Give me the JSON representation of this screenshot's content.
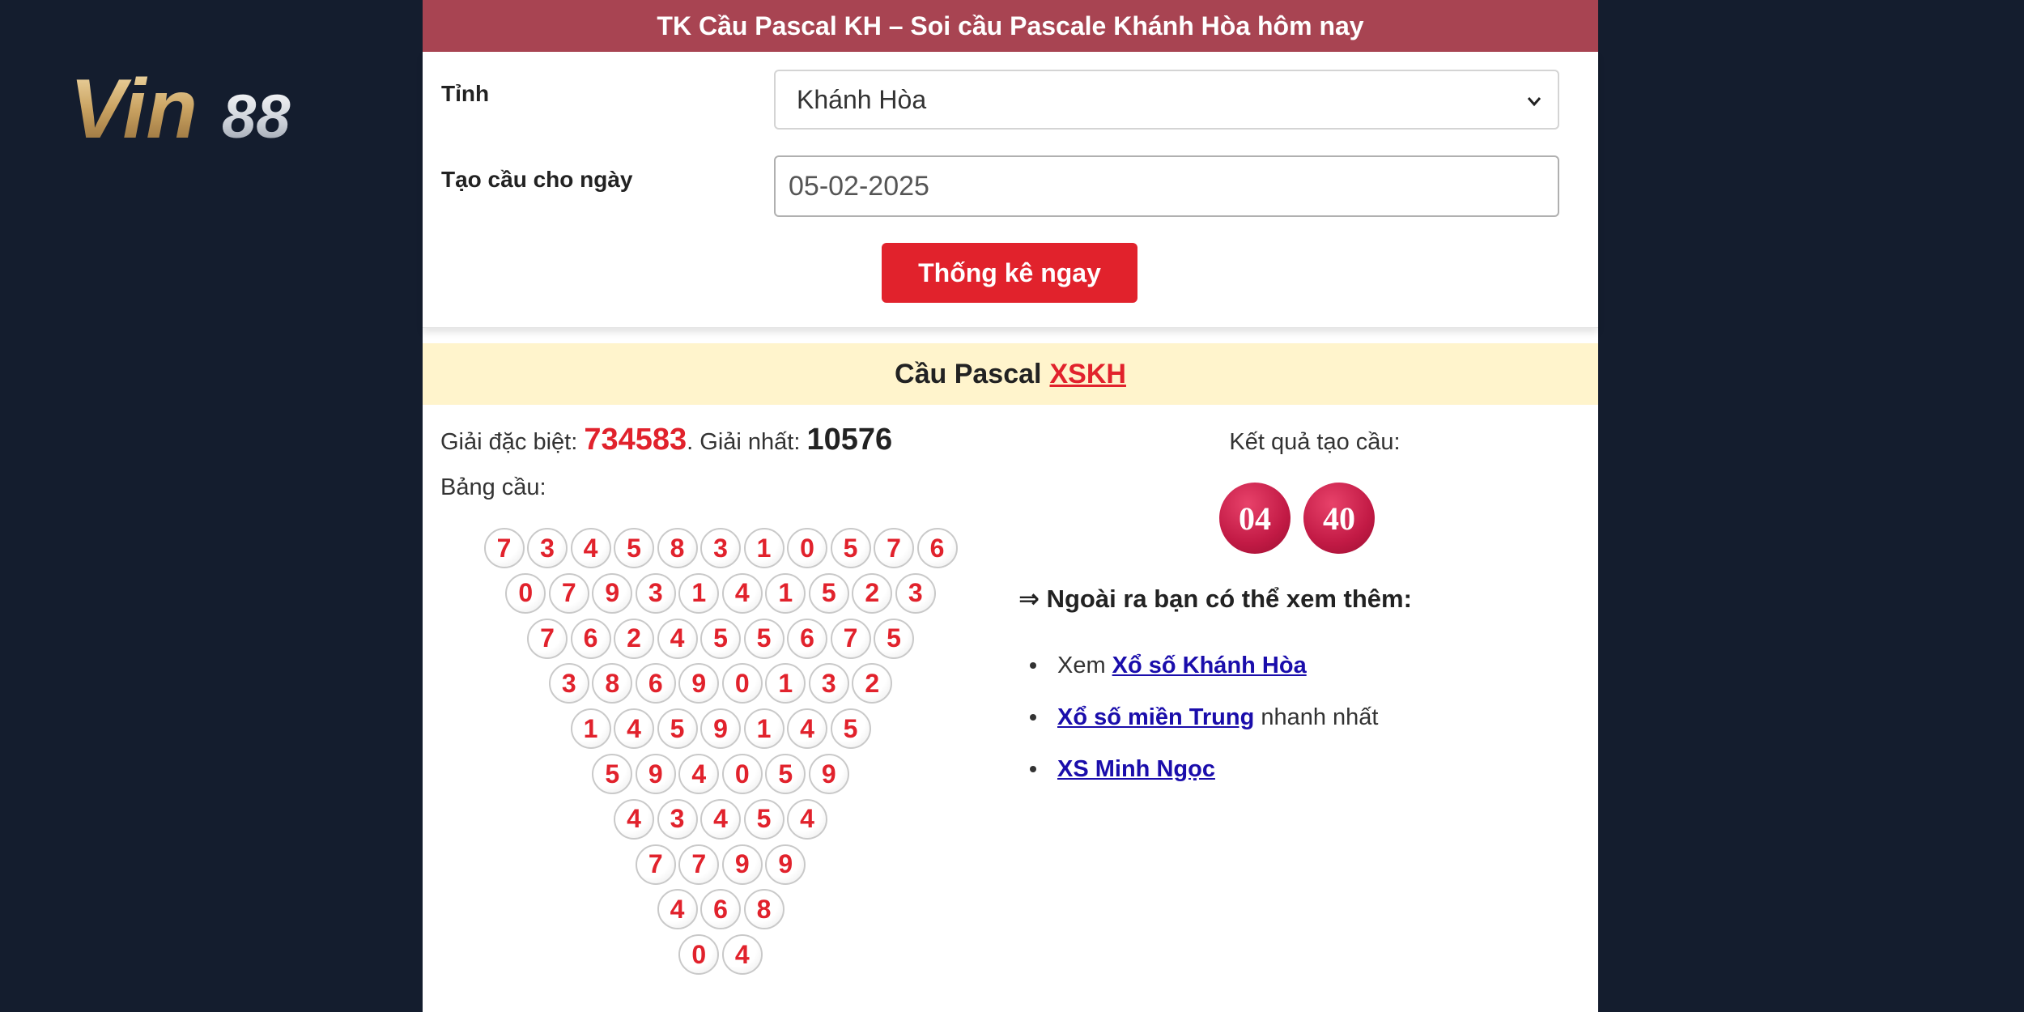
{
  "colors": {
    "background": "#141d2e",
    "header": "#a84452",
    "accent_red": "#e1222c",
    "section_bg": "#fff4cc",
    "link": "#1a0dab",
    "result_ball": "#c21a45"
  },
  "logo": {
    "text": "Vin88"
  },
  "header": {
    "title": "TK Cầu Pascal KH – Soi cầu Pascale Khánh Hòa hôm nay"
  },
  "form": {
    "province_label": "Tỉnh",
    "province_value": "Khánh Hòa",
    "date_label": "Tạo cầu cho ngày",
    "date_value": "05-02-2025",
    "submit_label": "Thống kê ngay"
  },
  "section": {
    "title": "Cầu Pascal",
    "title_accent": "XSKH"
  },
  "prizes": {
    "special_label": "Giải đặc biệt:",
    "special_value": "734583",
    "separator": ".",
    "first_label": "Giải nhất:",
    "first_value": "10576"
  },
  "board": {
    "label": "Bảng cầu:",
    "rows": [
      [
        "7",
        "3",
        "4",
        "5",
        "8",
        "3",
        "1",
        "0",
        "5",
        "7",
        "6"
      ],
      [
        "0",
        "7",
        "9",
        "3",
        "1",
        "4",
        "1",
        "5",
        "2",
        "3"
      ],
      [
        "7",
        "6",
        "2",
        "4",
        "5",
        "5",
        "6",
        "7",
        "5"
      ],
      [
        "3",
        "8",
        "6",
        "9",
        "0",
        "1",
        "3",
        "2"
      ],
      [
        "1",
        "4",
        "5",
        "9",
        "1",
        "4",
        "5"
      ],
      [
        "5",
        "9",
        "4",
        "0",
        "5",
        "9"
      ],
      [
        "4",
        "3",
        "4",
        "5",
        "4"
      ],
      [
        "7",
        "7",
        "9",
        "9"
      ],
      [
        "4",
        "6",
        "8"
      ],
      [
        "0",
        "4"
      ]
    ]
  },
  "result": {
    "label": "Kết quả tạo cầu:",
    "values": [
      "04",
      "40"
    ]
  },
  "more": {
    "heading": "⇒ Ngoài ra bạn có thể xem thêm:",
    "items": [
      {
        "prefix": "Xem",
        "link": "Xổ số Khánh Hòa",
        "suffix": ""
      },
      {
        "prefix": "",
        "link": "Xổ số miền Trung",
        "suffix": "nhanh nhất"
      },
      {
        "prefix": "",
        "link": "XS Minh Ngọc",
        "suffix": ""
      }
    ]
  }
}
